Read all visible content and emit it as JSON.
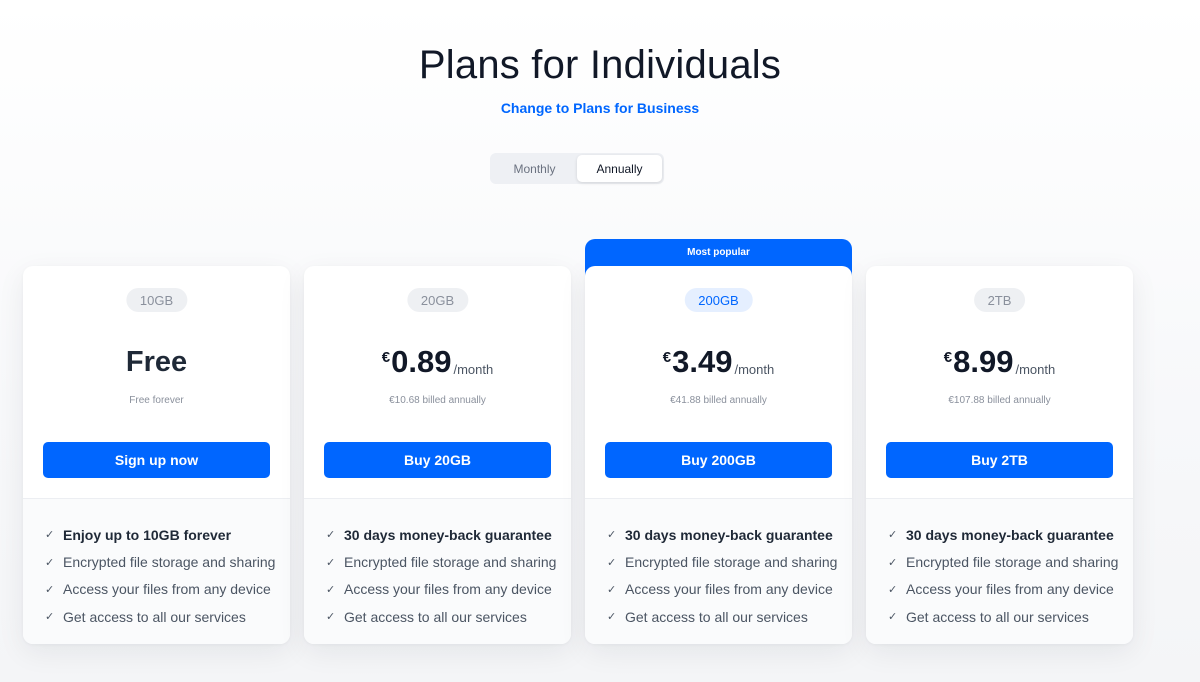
{
  "header": {
    "title": "Plans for Individuals",
    "switch_link": "Change to Plans for Business"
  },
  "billing_toggle": {
    "options": [
      "Monthly",
      "Annually"
    ],
    "selected": "Annually"
  },
  "colors": {
    "accent": "#0066ff",
    "text_dark": "#111827",
    "text_muted": "#8a909c"
  },
  "plans": [
    {
      "size": "10GB",
      "free_label": "Free",
      "note": "Free forever",
      "cta": "Sign up now",
      "features": [
        "Enjoy up to 10GB forever",
        "Encrypted file storage and sharing",
        "Access your files from any device",
        "Get access to all our services"
      ]
    },
    {
      "size": "20GB",
      "currency": "€",
      "amount": "0.89",
      "period": "/month",
      "note": "€10.68 billed annually",
      "cta": "Buy 20GB",
      "features": [
        "30 days money-back guarantee",
        "Encrypted file storage and sharing",
        "Access your files from any device",
        "Get access to all our services"
      ]
    },
    {
      "size": "200GB",
      "badge": "Most popular",
      "currency": "€",
      "amount": "3.49",
      "period": "/month",
      "note": "€41.88 billed annually",
      "cta": "Buy 200GB",
      "features": [
        "30 days money-back guarantee",
        "Encrypted file storage and sharing",
        "Access your files from any device",
        "Get access to all our services"
      ]
    },
    {
      "size": "2TB",
      "currency": "€",
      "amount": "8.99",
      "period": "/month",
      "note": "€107.88 billed annually",
      "cta": "Buy 2TB",
      "features": [
        "30 days money-back guarantee",
        "Encrypted file storage and sharing",
        "Access your files from any device",
        "Get access to all our services"
      ]
    }
  ]
}
